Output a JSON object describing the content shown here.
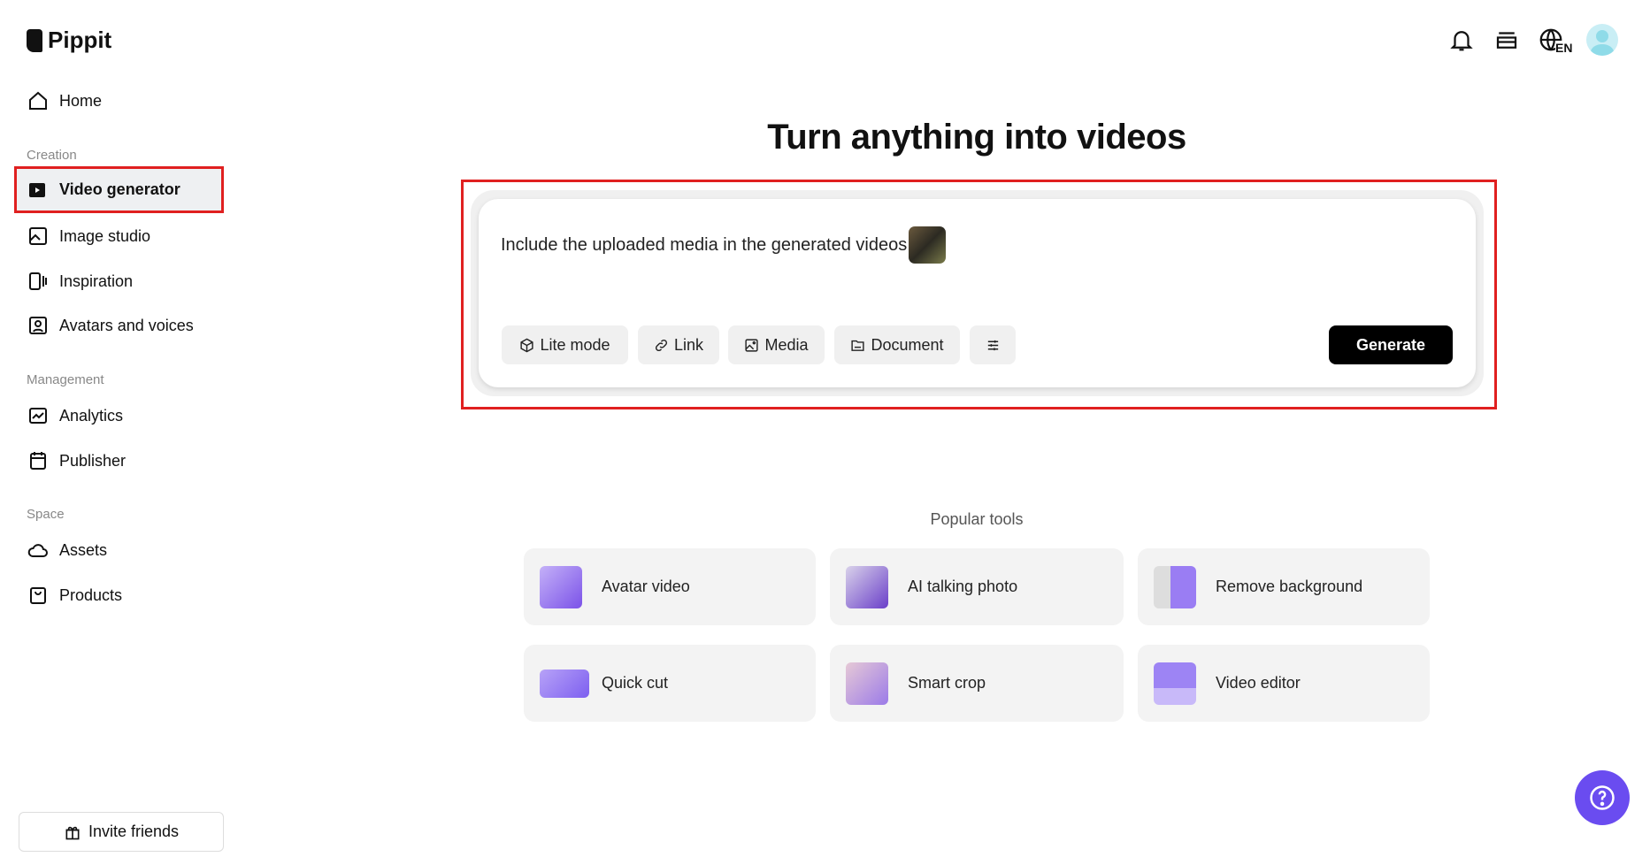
{
  "app": {
    "name": "Pippit"
  },
  "sidebar": {
    "home": "Home",
    "sections": {
      "creation": "Creation",
      "management": "Management",
      "space": "Space"
    },
    "items": [
      {
        "label": "Video generator",
        "icon": "video-plus-icon",
        "active": true
      },
      {
        "label": "Image studio",
        "icon": "image-plus-icon"
      },
      {
        "label": "Inspiration",
        "icon": "inspiration-icon"
      },
      {
        "label": "Avatars and voices",
        "icon": "avatar-icon"
      },
      {
        "label": "Analytics",
        "icon": "chart-icon"
      },
      {
        "label": "Publisher",
        "icon": "calendar-icon"
      },
      {
        "label": "Assets",
        "icon": "cloud-icon"
      },
      {
        "label": "Products",
        "icon": "bag-icon"
      }
    ],
    "invite": "Invite friends"
  },
  "header": {
    "language": "EN"
  },
  "main": {
    "title": "Turn anything into videos",
    "prompt": "Include the uploaded media in the generated videos",
    "chips": [
      "Lite mode",
      "Link",
      "Media",
      "Document"
    ],
    "generate": "Generate",
    "popular_title": "Popular tools",
    "tools": [
      {
        "label": "Avatar video",
        "color": "#9b7cf0"
      },
      {
        "label": "AI talking photo",
        "color": "#7e5bd6"
      },
      {
        "label": "Remove background",
        "color": "#8c6cf2"
      },
      {
        "label": "Quick cut",
        "color": "#a58cf5"
      },
      {
        "label": "Smart crop",
        "color": "#b39af0"
      },
      {
        "label": "Video editor",
        "color": "#8d72ee"
      }
    ]
  }
}
